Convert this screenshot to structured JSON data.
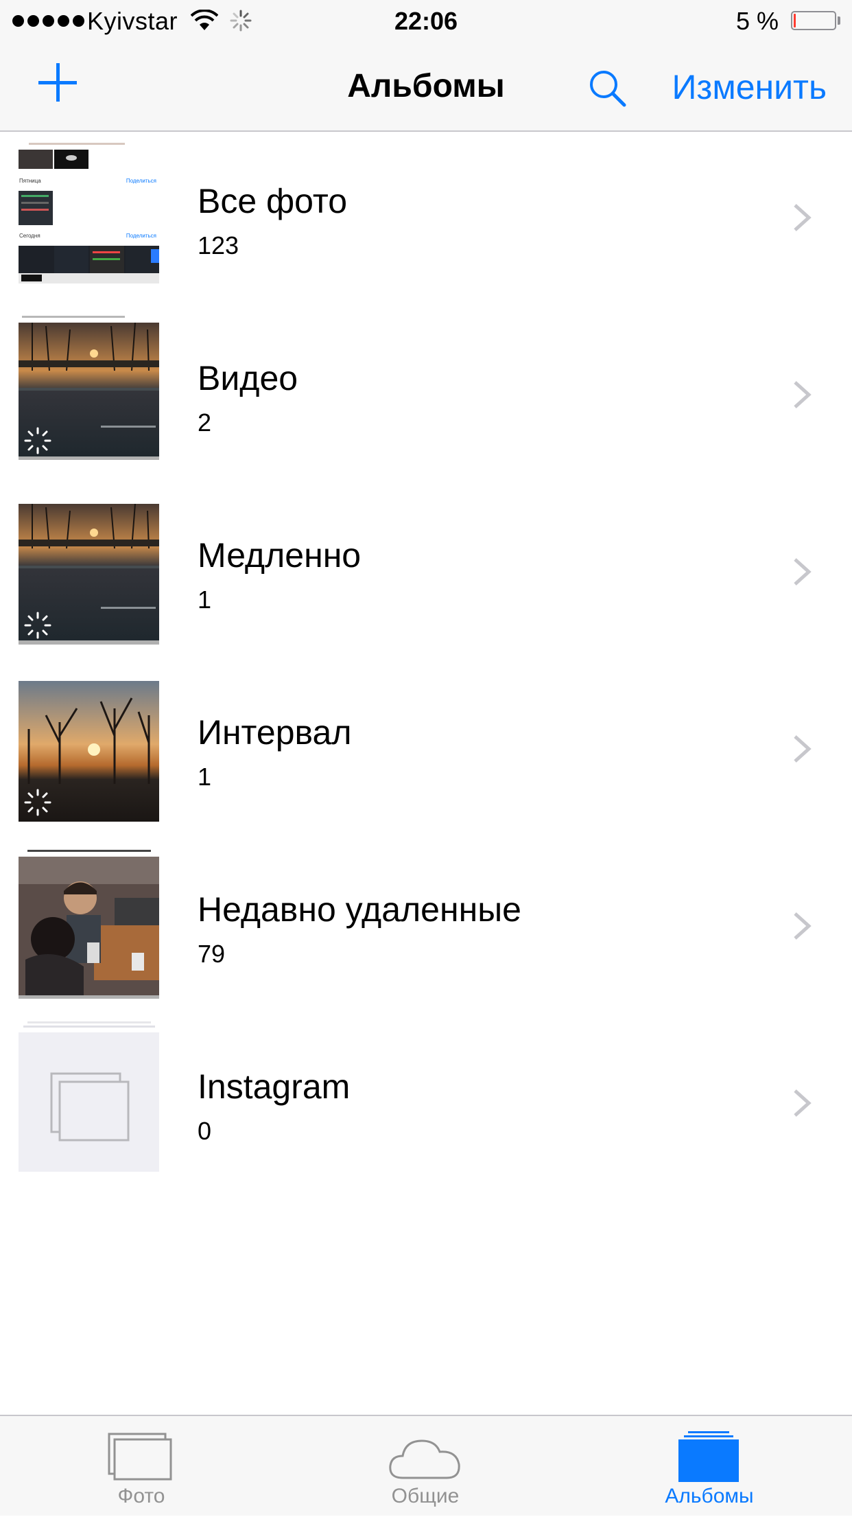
{
  "status_bar": {
    "carrier": "Kyivstar",
    "time": "22:06",
    "battery_text": "5 %",
    "battery_level": 0.05,
    "signal_bars": 5
  },
  "nav": {
    "title": "Альбомы",
    "edit_label": "Изменить",
    "icons": [
      "plus-icon",
      "search-icon"
    ]
  },
  "albums": [
    {
      "title": "Все фото",
      "count": "123"
    },
    {
      "title": "Видео",
      "count": "2"
    },
    {
      "title": "Медленно",
      "count": "1"
    },
    {
      "title": "Интервал",
      "count": "1"
    },
    {
      "title": "Недавно удаленные",
      "count": "79"
    },
    {
      "title": "Instagram",
      "count": "0"
    }
  ],
  "all_photos_thumb": {
    "section_1": "Пятница",
    "section_2": "Сегодня",
    "share": "Поделиться"
  },
  "tabs": [
    {
      "label": "Фото",
      "icon": "photos-icon",
      "active": false
    },
    {
      "label": "Общие",
      "icon": "cloud-icon",
      "active": false
    },
    {
      "label": "Альбомы",
      "icon": "albums-icon",
      "active": true
    }
  ],
  "colors": {
    "accent": "#0a7aff",
    "inactive_tab": "#929292",
    "bar_background": "#f7f7f7",
    "battery_low": "#ff3b30"
  }
}
